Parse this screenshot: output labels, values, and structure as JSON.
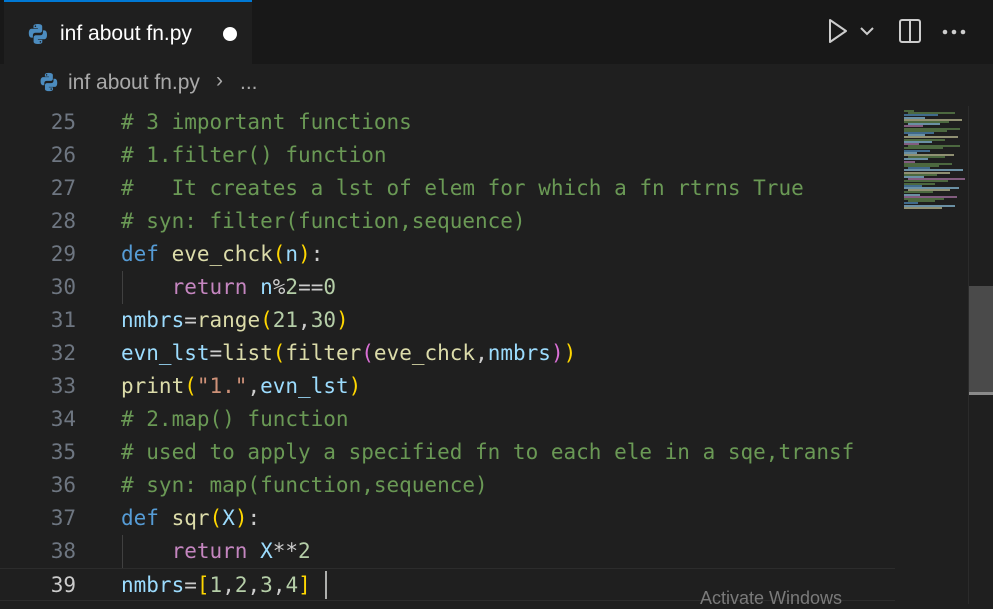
{
  "tab": {
    "filename": "inf about fn.py",
    "unsaved": true
  },
  "breadcrumb": {
    "file": "inf about fn.py",
    "separator": "›",
    "more": "..."
  },
  "toolbar": {
    "run": "run-icon",
    "run_menu": "chevron-down-icon",
    "split": "split-editor-icon",
    "more": "more-actions-icon"
  },
  "editor": {
    "lines": [
      {
        "n": "25",
        "tokens": [
          {
            "t": "# 3 important functions",
            "c": "comment"
          }
        ]
      },
      {
        "n": "26",
        "tokens": [
          {
            "t": "# 1.filter() function",
            "c": "comment"
          }
        ]
      },
      {
        "n": "27",
        "tokens": [
          {
            "t": "#   It creates a lst of elem for which a fn rtrns True",
            "c": "comment"
          }
        ]
      },
      {
        "n": "28",
        "tokens": [
          {
            "t": "# syn: filter(function,sequence)",
            "c": "comment"
          }
        ]
      },
      {
        "n": "29",
        "tokens": [
          {
            "t": "def",
            "c": "kw"
          },
          {
            "t": " ",
            "c": "plain"
          },
          {
            "t": "eve_chck",
            "c": "fn"
          },
          {
            "t": "(",
            "c": "p1"
          },
          {
            "t": "n",
            "c": "var"
          },
          {
            "t": ")",
            "c": "p1"
          },
          {
            "t": ":",
            "c": "plain"
          }
        ]
      },
      {
        "n": "30",
        "tokens": [
          {
            "t": "    ",
            "c": "plain"
          },
          {
            "t": "return",
            "c": "ctrl"
          },
          {
            "t": " ",
            "c": "plain"
          },
          {
            "t": "n",
            "c": "var"
          },
          {
            "t": "%",
            "c": "plain"
          },
          {
            "t": "2",
            "c": "num"
          },
          {
            "t": "==",
            "c": "plain"
          },
          {
            "t": "0",
            "c": "num"
          }
        ]
      },
      {
        "n": "31",
        "tokens": [
          {
            "t": "nmbrs",
            "c": "var"
          },
          {
            "t": "=",
            "c": "plain"
          },
          {
            "t": "range",
            "c": "fn"
          },
          {
            "t": "(",
            "c": "p1"
          },
          {
            "t": "21",
            "c": "num"
          },
          {
            "t": ",",
            "c": "plain"
          },
          {
            "t": "30",
            "c": "num"
          },
          {
            "t": ")",
            "c": "p1"
          }
        ]
      },
      {
        "n": "32",
        "tokens": [
          {
            "t": "evn_lst",
            "c": "var"
          },
          {
            "t": "=",
            "c": "plain"
          },
          {
            "t": "list",
            "c": "fn"
          },
          {
            "t": "(",
            "c": "p1"
          },
          {
            "t": "filter",
            "c": "fn"
          },
          {
            "t": "(",
            "c": "p2"
          },
          {
            "t": "eve_chck",
            "c": "fn"
          },
          {
            "t": ",",
            "c": "plain"
          },
          {
            "t": "nmbrs",
            "c": "var"
          },
          {
            "t": ")",
            "c": "p2"
          },
          {
            "t": ")",
            "c": "p1"
          }
        ]
      },
      {
        "n": "33",
        "tokens": [
          {
            "t": "print",
            "c": "fn"
          },
          {
            "t": "(",
            "c": "p1"
          },
          {
            "t": "\"1.\"",
            "c": "str"
          },
          {
            "t": ",",
            "c": "plain"
          },
          {
            "t": "evn_lst",
            "c": "var"
          },
          {
            "t": ")",
            "c": "p1"
          }
        ]
      },
      {
        "n": "34",
        "tokens": [
          {
            "t": "# 2.map() function",
            "c": "comment"
          }
        ]
      },
      {
        "n": "35",
        "tokens": [
          {
            "t": "# used to apply a specified fn to each ele in a sqe,transf",
            "c": "comment"
          }
        ]
      },
      {
        "n": "36",
        "tokens": [
          {
            "t": "# syn: map(function,sequence)",
            "c": "comment"
          }
        ]
      },
      {
        "n": "37",
        "tokens": [
          {
            "t": "def",
            "c": "kw"
          },
          {
            "t": " ",
            "c": "plain"
          },
          {
            "t": "sqr",
            "c": "fn"
          },
          {
            "t": "(",
            "c": "p1"
          },
          {
            "t": "X",
            "c": "var"
          },
          {
            "t": ")",
            "c": "p1"
          },
          {
            "t": ":",
            "c": "plain"
          }
        ]
      },
      {
        "n": "38",
        "tokens": [
          {
            "t": "    ",
            "c": "plain"
          },
          {
            "t": "return",
            "c": "ctrl"
          },
          {
            "t": " ",
            "c": "plain"
          },
          {
            "t": "X",
            "c": "var"
          },
          {
            "t": "**",
            "c": "plain"
          },
          {
            "t": "2",
            "c": "num"
          }
        ]
      },
      {
        "n": "39",
        "current": true,
        "tokens": [
          {
            "t": "nmbrs",
            "c": "var"
          },
          {
            "t": "=",
            "c": "plain"
          },
          {
            "t": "[",
            "c": "p1"
          },
          {
            "t": "1",
            "c": "num"
          },
          {
            "t": ",",
            "c": "plain"
          },
          {
            "t": "2",
            "c": "num"
          },
          {
            "t": ",",
            "c": "plain"
          },
          {
            "t": "3",
            "c": "num"
          },
          {
            "t": ",",
            "c": "plain"
          },
          {
            "t": "4",
            "c": "num"
          },
          {
            "t": "]",
            "c": "p1"
          }
        ]
      }
    ]
  },
  "watermark": "Activate Windows"
}
